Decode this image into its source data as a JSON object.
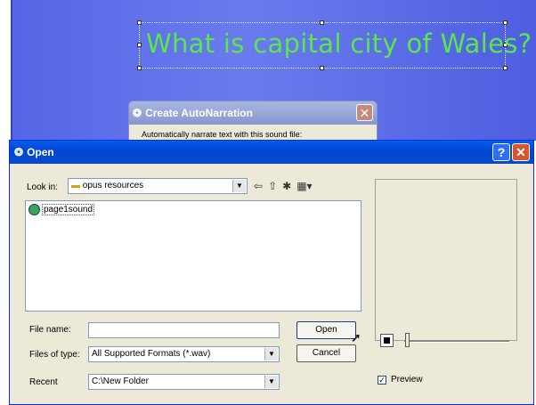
{
  "slide": {
    "title": "What is capital city of Wales?"
  },
  "narration_dialog": {
    "title": "Create AutoNarration",
    "body": "Automatically narrate text with this sound file:"
  },
  "open_dialog": {
    "title": "Open",
    "look_in_label": "Look in:",
    "look_in_value": "opus resources",
    "files": [
      "page1sound"
    ],
    "file_name_label": "File name:",
    "file_name_value": "",
    "files_of_type_label": "Files of type:",
    "files_of_type_value": "All Supported Formats (*.wav)",
    "recent_label": "Recent",
    "recent_value": "C:\\New Folder",
    "open_label": "Open",
    "cancel_label": "Cancel",
    "preview_label": "Preview",
    "preview_checked": true
  },
  "colors": {
    "slide_bg": "#5566e6",
    "title_text": "#59e84a",
    "titlebar": "#0a5bf0"
  }
}
